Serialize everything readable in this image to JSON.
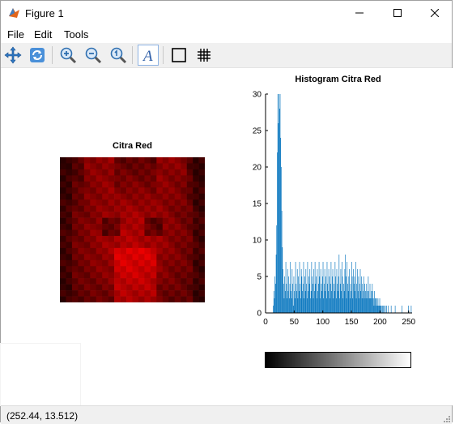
{
  "window": {
    "title": "Figure 1",
    "icon": "matlab-figure-icon",
    "controls": [
      "minimize-icon",
      "maximize-icon",
      "close-icon"
    ]
  },
  "menu": [
    {
      "label": "File"
    },
    {
      "label": "Edit"
    },
    {
      "label": "Tools"
    }
  ],
  "toolbar": {
    "buttons": [
      "pan-icon",
      "rotate-icon",
      "zoom-in-icon",
      "zoom-out-icon",
      "reset-view-icon",
      "insert-text-icon",
      "box-icon",
      "grid-icon"
    ]
  },
  "image_axes": {
    "title": "Citra Red",
    "colors": {
      "dark": "#2a0000",
      "mid": "#8a0000",
      "bright": "#e60000"
    }
  },
  "status": {
    "coords": "(252.44, 13.512)"
  },
  "chart_data": {
    "type": "bar",
    "title": "Histogram Citra Red",
    "xlabel": "",
    "ylabel": "",
    "xlim": [
      0,
      256
    ],
    "ylim": [
      0,
      30
    ],
    "xticks": [
      0,
      50,
      100,
      150,
      200,
      250
    ],
    "yticks": [
      0,
      5,
      10,
      15,
      20,
      25,
      30
    ],
    "color": "#0072bd",
    "x": [
      13,
      14,
      15,
      16,
      17,
      18,
      19,
      20,
      21,
      22,
      23,
      24,
      25,
      26,
      27,
      28,
      29,
      30,
      31,
      32,
      33,
      34,
      35,
      36,
      37,
      38,
      39,
      40,
      41,
      42,
      43,
      44,
      45,
      46,
      47,
      48,
      49,
      50,
      51,
      52,
      53,
      54,
      55,
      56,
      57,
      58,
      59,
      60,
      61,
      62,
      63,
      64,
      65,
      66,
      67,
      68,
      69,
      70,
      71,
      72,
      73,
      74,
      75,
      76,
      77,
      78,
      79,
      80,
      81,
      82,
      83,
      84,
      85,
      86,
      87,
      88,
      89,
      90,
      91,
      92,
      93,
      94,
      95,
      96,
      97,
      98,
      99,
      100,
      101,
      102,
      103,
      104,
      105,
      106,
      107,
      108,
      109,
      110,
      111,
      112,
      113,
      114,
      115,
      116,
      117,
      118,
      119,
      120,
      121,
      122,
      123,
      124,
      125,
      126,
      127,
      128,
      129,
      130,
      131,
      132,
      133,
      134,
      135,
      136,
      137,
      138,
      139,
      140,
      141,
      142,
      143,
      144,
      145,
      146,
      147,
      148,
      149,
      150,
      151,
      152,
      153,
      154,
      155,
      156,
      157,
      158,
      159,
      160,
      161,
      162,
      163,
      164,
      165,
      166,
      167,
      168,
      169,
      170,
      171,
      172,
      173,
      174,
      175,
      176,
      177,
      178,
      179,
      180,
      181,
      182,
      183,
      184,
      185,
      186,
      187,
      188,
      189,
      190,
      191,
      192,
      193,
      194,
      195,
      196,
      197,
      198,
      199,
      200,
      201,
      202,
      203,
      204,
      205,
      206,
      207,
      208,
      209,
      210,
      211,
      212,
      213,
      214,
      215,
      216,
      217,
      218,
      219,
      220,
      221,
      222,
      223,
      224,
      225,
      226,
      227,
      228,
      229,
      230,
      231,
      232,
      233,
      234,
      235,
      236,
      237,
      238,
      239,
      240,
      241,
      242,
      243,
      244,
      245,
      246,
      247,
      248,
      249,
      250,
      251,
      252,
      253,
      254,
      255
    ],
    "values": [
      1,
      3,
      2,
      5,
      4,
      8,
      12,
      22,
      30,
      26,
      30,
      28,
      30,
      24,
      20,
      14,
      9,
      6,
      4,
      2,
      5,
      3,
      7,
      4,
      2,
      6,
      3,
      5,
      2,
      4,
      7,
      3,
      2,
      6,
      4,
      1,
      5,
      3,
      2,
      7,
      4,
      3,
      6,
      2,
      5,
      3,
      7,
      4,
      2,
      6,
      5,
      3,
      4,
      7,
      2,
      5,
      3,
      6,
      4,
      2,
      7,
      3,
      5,
      4,
      6,
      2,
      3,
      7,
      5,
      4,
      2,
      6,
      3,
      7,
      4,
      5,
      2,
      6,
      3,
      4,
      7,
      5,
      2,
      6,
      4,
      3,
      5,
      7,
      2,
      4,
      6,
      3,
      5,
      2,
      7,
      4,
      3,
      6,
      5,
      2,
      4,
      7,
      3,
      5,
      6,
      2,
      4,
      3,
      7,
      5,
      2,
      6,
      4,
      3,
      5,
      8,
      2,
      4,
      6,
      3,
      7,
      5,
      2,
      4,
      3,
      6,
      8,
      5,
      2,
      7,
      4,
      3,
      5,
      6,
      2,
      4,
      3,
      7,
      5,
      2,
      6,
      4,
      5,
      3,
      7,
      2,
      4,
      6,
      3,
      5,
      2,
      4,
      6,
      3,
      5,
      2,
      4,
      3,
      5,
      2,
      4,
      3,
      2,
      4,
      3,
      2,
      5,
      3,
      2,
      4,
      2,
      3,
      2,
      4,
      3,
      2,
      1,
      3,
      2,
      2,
      1,
      2,
      1,
      2,
      1,
      1,
      2,
      1,
      1,
      1,
      0,
      1,
      1,
      0,
      1,
      0,
      1,
      0,
      1,
      0,
      0,
      1,
      0,
      0,
      0,
      0,
      1,
      0,
      0,
      0,
      0,
      0,
      0,
      1,
      0,
      0,
      0,
      0,
      0,
      0,
      0,
      0,
      0,
      0,
      0,
      1,
      0,
      0,
      0,
      0,
      0,
      0,
      0,
      0,
      0,
      0,
      1,
      0,
      0,
      0,
      0,
      1
    ]
  }
}
